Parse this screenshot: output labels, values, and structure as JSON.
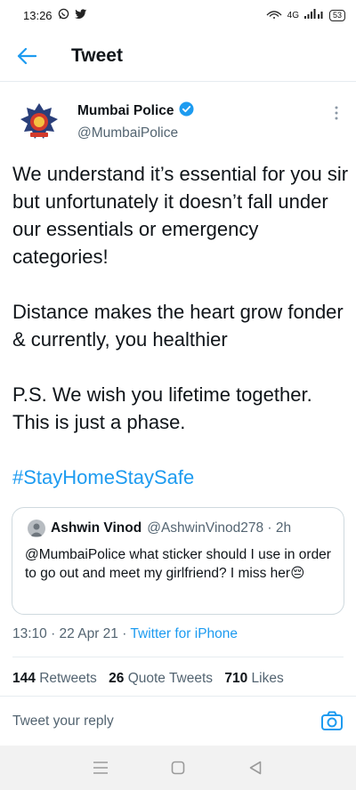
{
  "status_bar": {
    "time": "13:26",
    "network_labels": "4G",
    "battery_level": "53"
  },
  "header": {
    "title": "Tweet"
  },
  "author": {
    "name": "Mumbai Police",
    "handle": "@MumbaiPolice"
  },
  "tweet": {
    "paragraph_1": "We understand it’s essential for you sir but unfortunately it doesn’t fall under our essentials or emergency categories!",
    "paragraph_2": "Distance makes the heart grow fonder & currently, you healthier",
    "paragraph_3": "P.S. We wish you lifetime together. This is just a phase.",
    "hashtag": "#StayHomeStaySafe"
  },
  "quoted_tweet": {
    "name": "Ashwin Vinod",
    "handle_time": "@AshwinVinod278 · 2h",
    "text": "@MumbaiPolice what sticker should I use in order to go out and meet my girlfriend? I miss her😔"
  },
  "meta": {
    "timestamp": "13:10 · 22 Apr 21 · ",
    "source": "Twitter for iPhone"
  },
  "stats": {
    "retweets_count": "144",
    "retweets_label": "Retweets",
    "quotes_count": "26",
    "quotes_label": "Quote Tweets",
    "likes_count": "710",
    "likes_label": "Likes"
  },
  "reply": {
    "placeholder": "Tweet your reply"
  },
  "colors": {
    "accent": "#1d9bf0",
    "text": "#0f1419",
    "secondary": "#536471"
  }
}
